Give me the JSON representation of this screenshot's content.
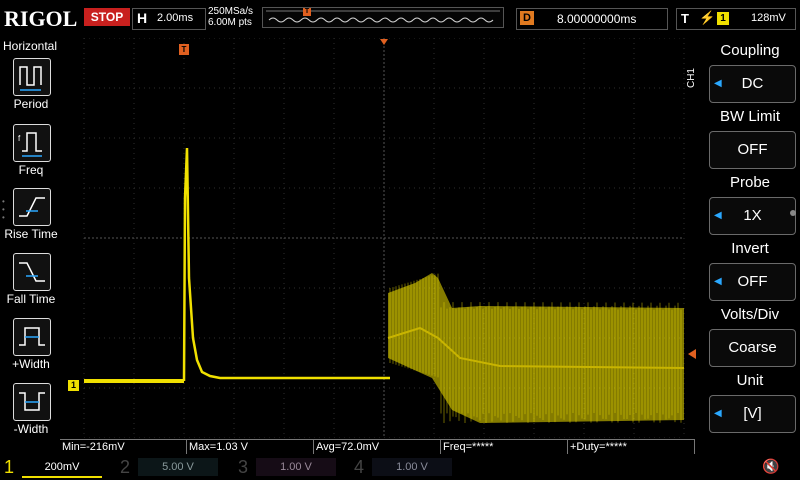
{
  "app": {
    "logo": "RIGOL",
    "run_state": "STOP"
  },
  "timebase": {
    "label": "H",
    "value": "2.00ms"
  },
  "acquisition": {
    "sample_rate": "250MSa/s",
    "points": "6.00M pts"
  },
  "delay": {
    "label": "D",
    "value": "8.00000000ms"
  },
  "trigger": {
    "label": "T",
    "edge_icon": "rising-edge-icon",
    "source": "1",
    "level": "128mV",
    "marker": "T"
  },
  "left_menu": {
    "title": "Horizontal",
    "items": [
      {
        "label": "Period",
        "icon": "period-icon"
      },
      {
        "label": "Freq",
        "icon": "freq-icon"
      },
      {
        "label": "Rise Time",
        "icon": "rise-time-icon"
      },
      {
        "label": "Fall Time",
        "icon": "fall-time-icon"
      },
      {
        "label": "+Width",
        "icon": "pos-width-icon"
      },
      {
        "label": "-Width",
        "icon": "neg-width-icon"
      }
    ]
  },
  "right_menu": {
    "channel_tag": "CH1",
    "items": [
      {
        "title": "Coupling",
        "value": "DC"
      },
      {
        "title": "BW Limit",
        "value": "OFF"
      },
      {
        "title": "Probe",
        "value": "1X"
      },
      {
        "title": "Invert",
        "value": "OFF"
      },
      {
        "title": "Volts/Div",
        "value": "Coarse"
      },
      {
        "title": "Unit",
        "value": "[V]"
      }
    ]
  },
  "measurements": {
    "min": "Min=-216mV",
    "max": "Max=1.03 V",
    "avg": "Avg=72.0mV",
    "freq": "Freq=*****",
    "duty": "+Duty=*****"
  },
  "channels": [
    {
      "num": "1",
      "scale": "200mV",
      "color": "#f0e000",
      "active": true
    },
    {
      "num": "2",
      "scale": "5.00 V",
      "color": "#2ec4e8",
      "active": false
    },
    {
      "num": "3",
      "scale": "1.00 V",
      "color": "#e040c8",
      "active": false
    },
    {
      "num": "4",
      "scale": "1.00 V",
      "color": "#3a78e0",
      "active": false
    }
  ],
  "ch1_ground_marker": "1",
  "speaker_icon": "speaker-muted-icon",
  "colors": {
    "trace": "#f0e000",
    "accent_orange": "#e07a20",
    "stop_red": "#c8201e",
    "grid": "#3a3a3a"
  }
}
